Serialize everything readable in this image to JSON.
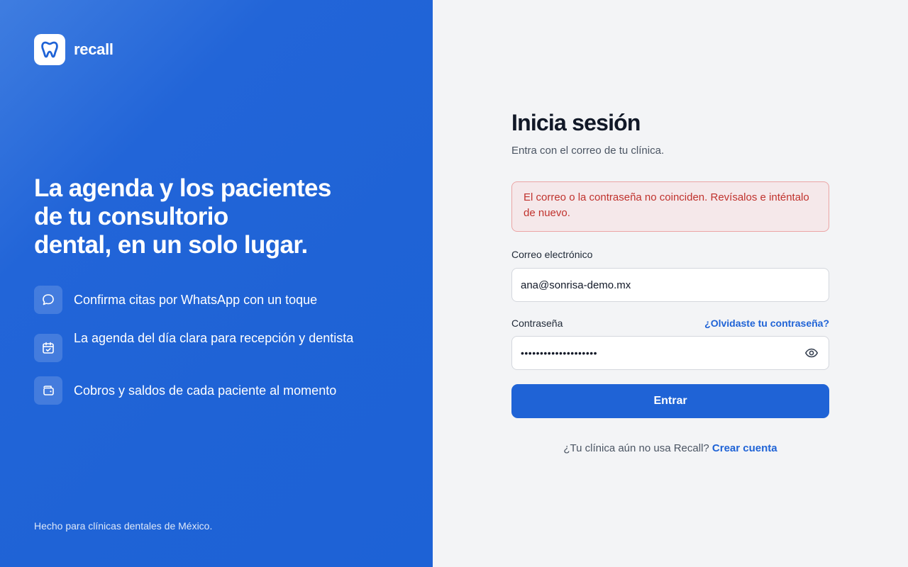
{
  "brand": {
    "name": "recall",
    "logo_icon": "tooth-icon"
  },
  "hero": {
    "headline_line1": "La agenda y los pacientes",
    "headline_line2": "de tu consultorio",
    "headline_line3": "dental, en un solo lugar."
  },
  "features": [
    {
      "icon": "chat-bubble-icon",
      "text": "Confirma citas por WhatsApp con un toque"
    },
    {
      "icon": "calendar-check-icon",
      "text": "La agenda del día clara para recepción y dentista"
    },
    {
      "icon": "wallet-icon",
      "text": "Cobros y saldos de cada paciente al momento"
    }
  ],
  "footer_note": "Hecho para clínicas dentales de México.",
  "login": {
    "title": "Inicia sesión",
    "subtitle": "Entra con el correo de tu clínica.",
    "error_message": "El correo o la contraseña no coinciden. Revísalos e inténtalo de nuevo.",
    "email_label": "Correo electrónico",
    "email_value": "ana@sonrisa-demo.mx",
    "password_label": "Contraseña",
    "forgot_link": "¿Olvidaste tu contraseña?",
    "password_masked": "••••••••••••••••••••",
    "password_toggle_icon": "eye-icon",
    "submit_label": "Entrar",
    "signup_prompt": "¿Tu clínica aún no usa Recall?",
    "signup_link": "Crear cuenta"
  },
  "colors": {
    "primary": "#1f63d6",
    "error_text": "#c0322d",
    "error_bg": "#f5e8ea",
    "panel_bg": "#f3f4f6"
  }
}
